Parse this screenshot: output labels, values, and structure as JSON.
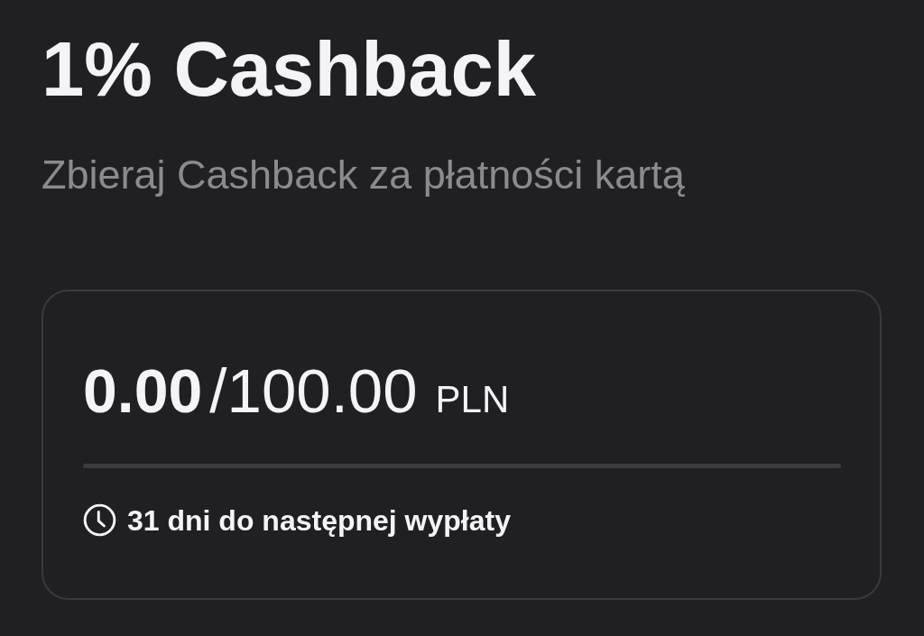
{
  "header": {
    "title": "1% Cashback",
    "subtitle": "Zbieraj Cashback za płatności kartą"
  },
  "cashback_card": {
    "amount": "0.00",
    "limit": "/100.00",
    "currency": "PLN",
    "progress": {
      "level": 0
    },
    "payout_note": "31 dni do następnej wypłaty"
  }
}
